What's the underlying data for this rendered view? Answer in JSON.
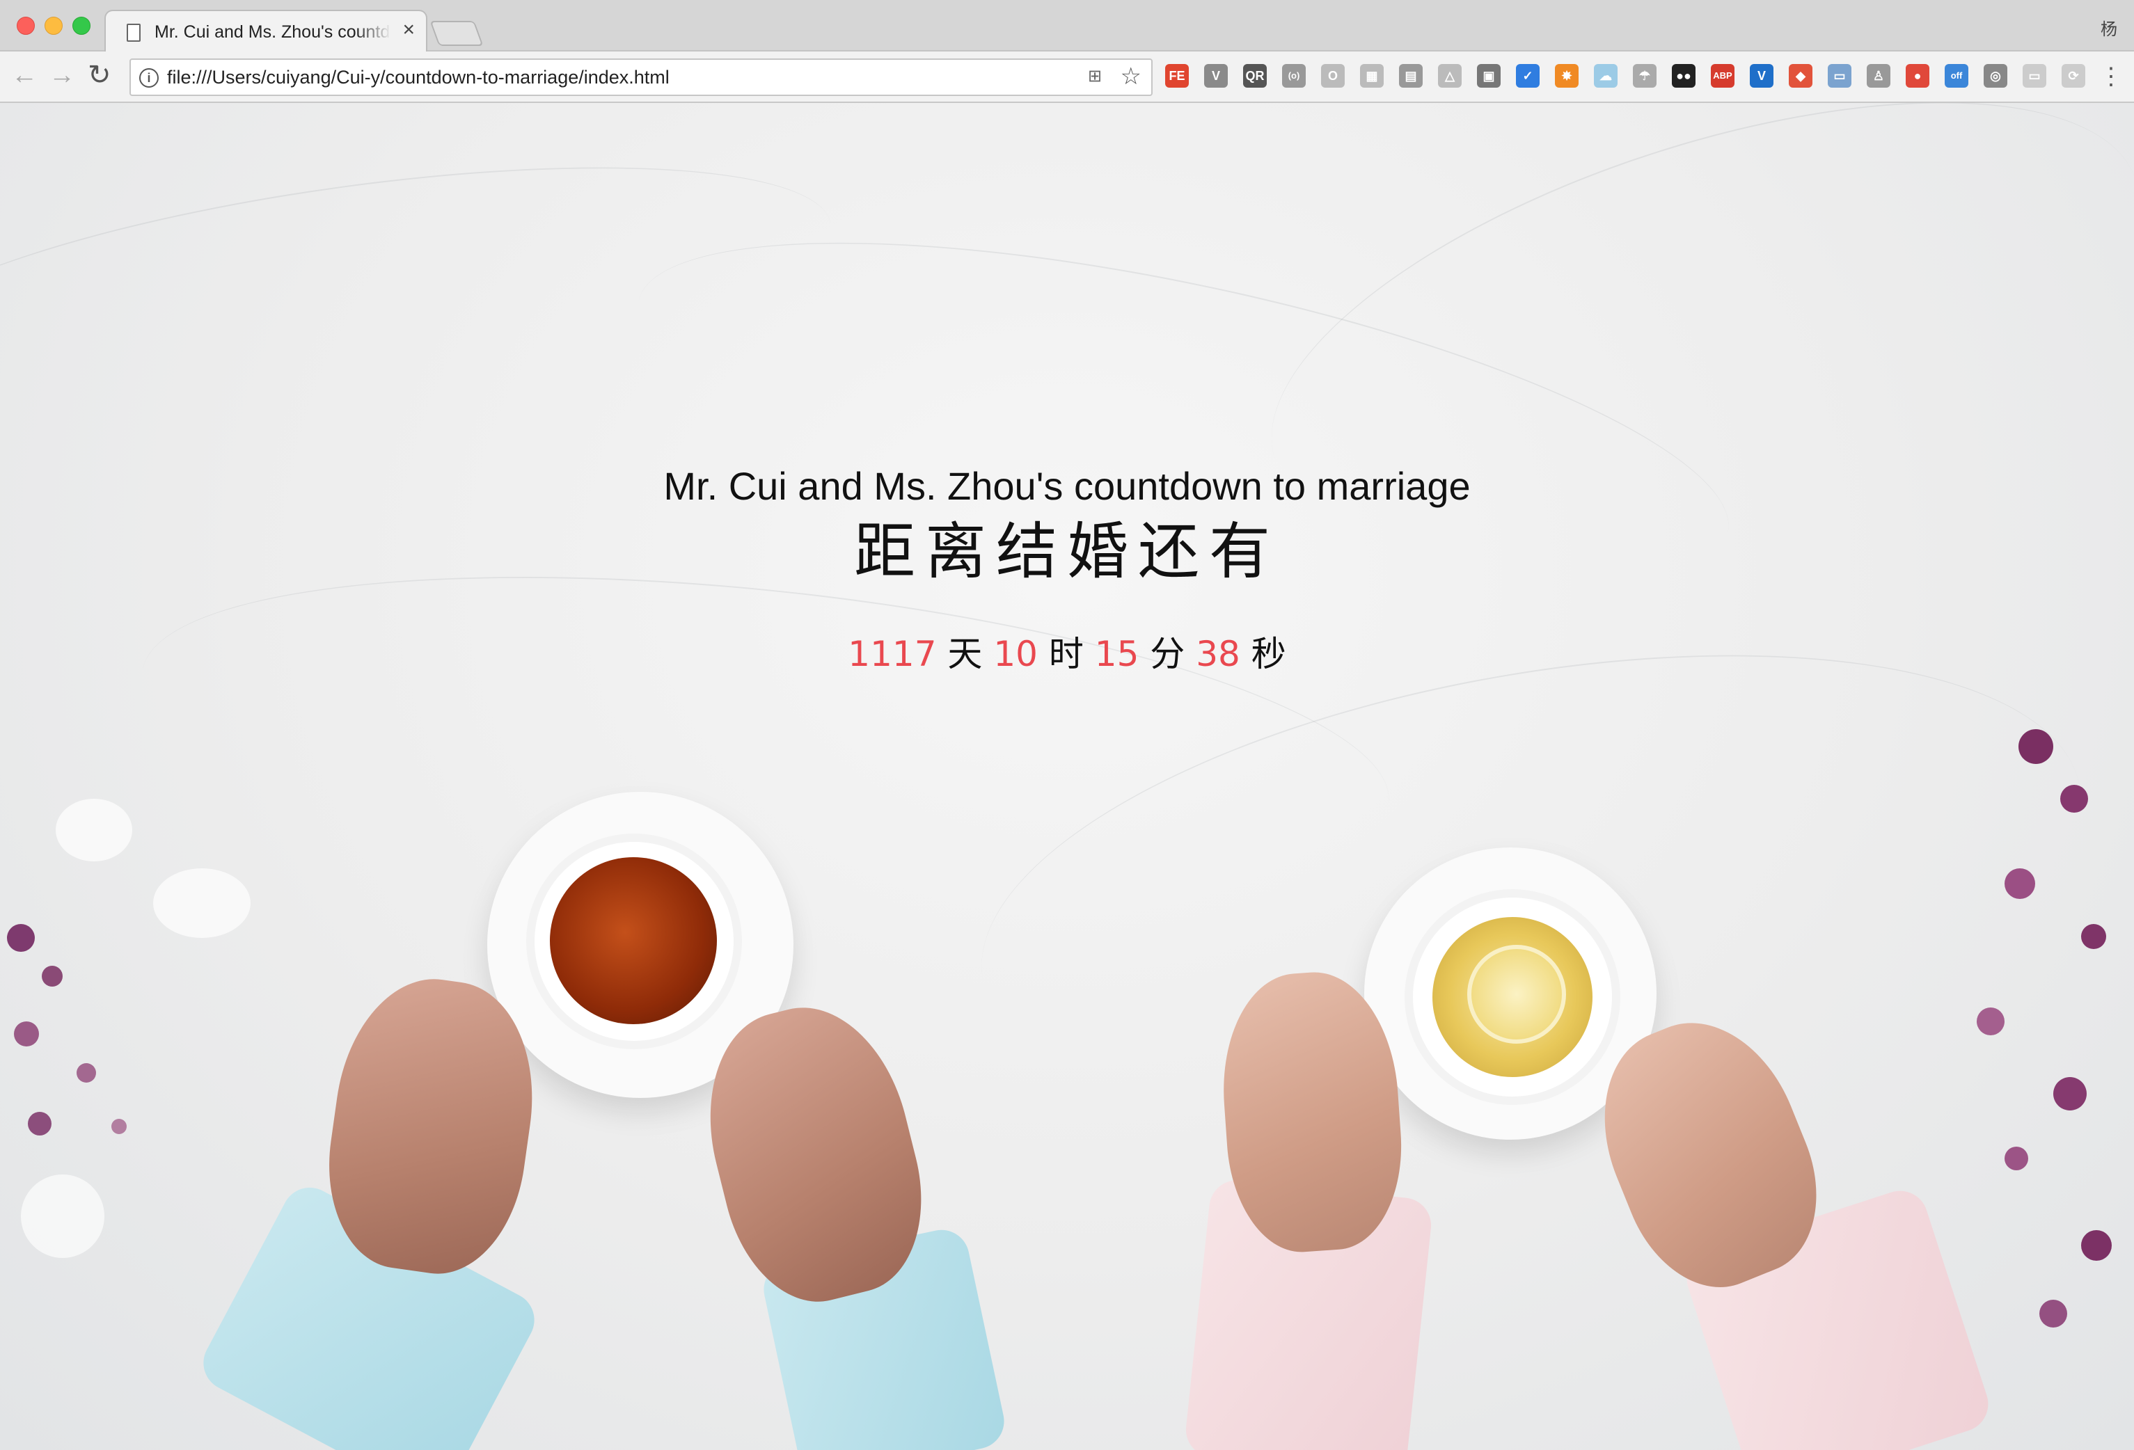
{
  "browser": {
    "tab_title": "Mr. Cui and Ms. Zhou's countdown to marriage",
    "tab_close": "×",
    "profile_label": "杨",
    "url": "file:///Users/cuiyang/Cui-y/countdown-to-marriage/index.html",
    "extensions": [
      "FE",
      "V",
      "QR",
      "(o)",
      "O",
      "▦",
      "▤",
      "△",
      "▣",
      "✓",
      "✸",
      "☁",
      "☂",
      "●●",
      "ABP",
      "V",
      "◆",
      "▭",
      "♙",
      "●",
      "off",
      "◎",
      "▭",
      "⟳"
    ],
    "menu": "⋮"
  },
  "page": {
    "title_en": "Mr. Cui and Ms. Zhou's countdown to marriage",
    "title_zh": "距离结婚还有",
    "countdown": {
      "days": "1117",
      "days_unit": "天",
      "hours": "10",
      "hours_unit": "时",
      "minutes": "15",
      "minutes_unit": "分",
      "seconds": "38",
      "seconds_unit": "秒"
    },
    "accent_color": "#e9484f"
  }
}
